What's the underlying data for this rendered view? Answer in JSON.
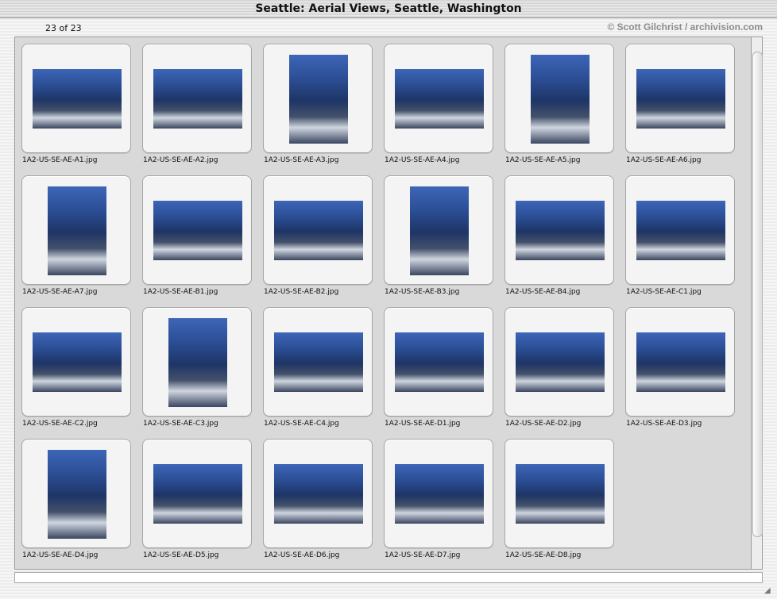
{
  "window": {
    "title": "Seattle: Aerial Views, Seattle, Washington"
  },
  "header": {
    "item_count": "23 of 23",
    "credit": "© Scott Gilchrist / archivision.com"
  },
  "thumbnails": [
    {
      "filename": "1A2-US-SE-AE-A1.jpg",
      "orientation": "landscape"
    },
    {
      "filename": "1A2-US-SE-AE-A2.jpg",
      "orientation": "landscape"
    },
    {
      "filename": "1A2-US-SE-AE-A3.jpg",
      "orientation": "portrait"
    },
    {
      "filename": "1A2-US-SE-AE-A4.jpg",
      "orientation": "landscape"
    },
    {
      "filename": "1A2-US-SE-AE-A5.jpg",
      "orientation": "portrait"
    },
    {
      "filename": "1A2-US-SE-AE-A6.jpg",
      "orientation": "landscape"
    },
    {
      "filename": "1A2-US-SE-AE-A7.jpg",
      "orientation": "portrait"
    },
    {
      "filename": "1A2-US-SE-AE-B1.jpg",
      "orientation": "landscape"
    },
    {
      "filename": "1A2-US-SE-AE-B2.jpg",
      "orientation": "landscape"
    },
    {
      "filename": "1A2-US-SE-AE-B3.jpg",
      "orientation": "portrait"
    },
    {
      "filename": "1A2-US-SE-AE-B4.jpg",
      "orientation": "landscape"
    },
    {
      "filename": "1A2-US-SE-AE-C1.jpg",
      "orientation": "landscape"
    },
    {
      "filename": "1A2-US-SE-AE-C2.jpg",
      "orientation": "landscape"
    },
    {
      "filename": "1A2-US-SE-AE-C3.jpg",
      "orientation": "portrait"
    },
    {
      "filename": "1A2-US-SE-AE-C4.jpg",
      "orientation": "landscape"
    },
    {
      "filename": "1A2-US-SE-AE-D1.jpg",
      "orientation": "landscape"
    },
    {
      "filename": "1A2-US-SE-AE-D2.jpg",
      "orientation": "landscape"
    },
    {
      "filename": "1A2-US-SE-AE-D3.jpg",
      "orientation": "landscape"
    },
    {
      "filename": "1A2-US-SE-AE-D4.jpg",
      "orientation": "portrait"
    },
    {
      "filename": "1A2-US-SE-AE-D5.jpg",
      "orientation": "landscape"
    },
    {
      "filename": "1A2-US-SE-AE-D6.jpg",
      "orientation": "landscape"
    },
    {
      "filename": "1A2-US-SE-AE-D7.jpg",
      "orientation": "landscape"
    },
    {
      "filename": "1A2-US-SE-AE-D8.jpg",
      "orientation": "landscape"
    }
  ],
  "colors": {
    "sky": "#3d66b8",
    "water": "#2b4d93",
    "city": "#44516a"
  }
}
